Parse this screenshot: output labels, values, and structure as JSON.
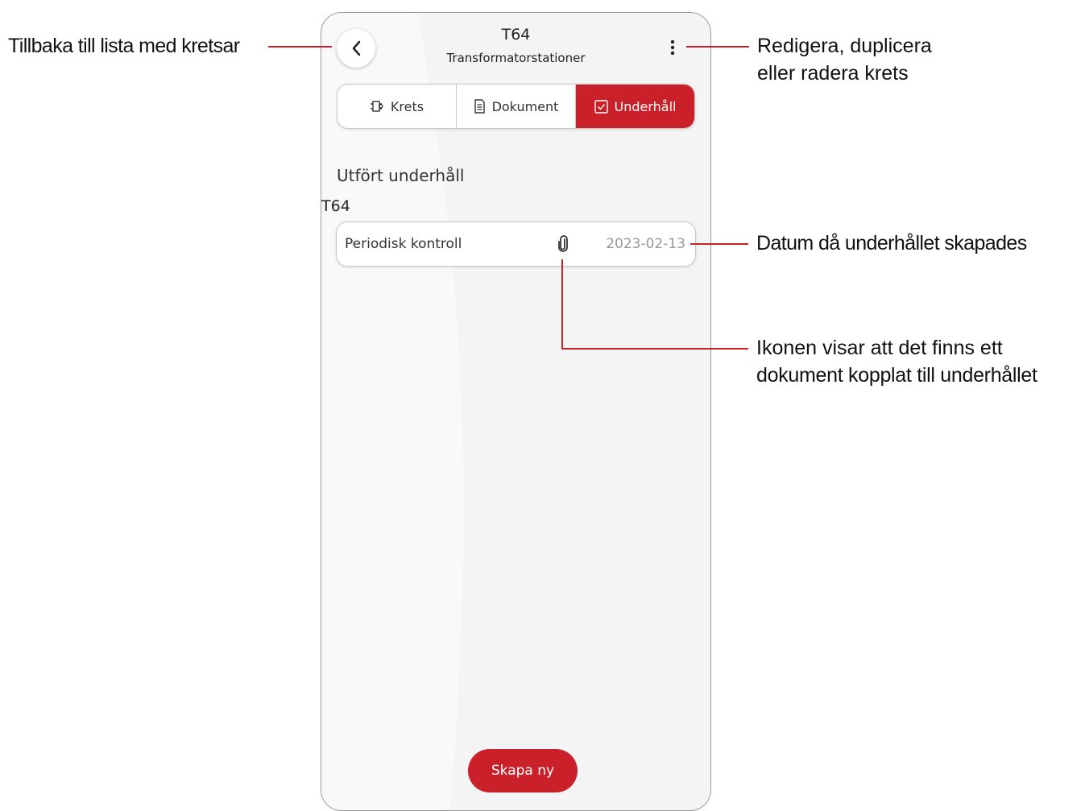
{
  "header": {
    "title": "T64",
    "subtitle": "Transformatorstationer"
  },
  "tabs": [
    {
      "label": "Krets",
      "icon": "circuit-icon",
      "active": false
    },
    {
      "label": "Dokument",
      "icon": "document-icon",
      "active": false
    },
    {
      "label": "Underhåll",
      "icon": "checkbox-icon",
      "active": true
    }
  ],
  "main": {
    "section_heading": "Utfört underhåll",
    "group_label": "T64",
    "items": [
      {
        "title": "Periodisk kontroll",
        "has_attachment": true,
        "attachment_icon": "paperclip-icon",
        "date": "2023-02-13"
      }
    ],
    "create_button": "Skapa ny"
  },
  "annotations": {
    "back": "Tillbaka till lista med kretsar",
    "menu_line1": "Redigera, duplicera",
    "menu_line2": "eller radera krets",
    "date": "Datum då underhållet skapades",
    "attachment_line1": "Ikonen visar att det finns ett",
    "attachment_line2": "dokument kopplat till underhållet"
  },
  "colors": {
    "accent": "#c9202a",
    "background": "#f4f4f4",
    "card": "#ffffff"
  }
}
